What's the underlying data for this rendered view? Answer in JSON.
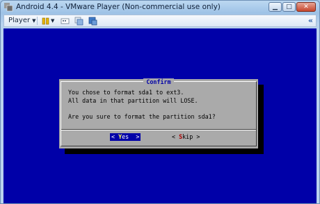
{
  "window": {
    "title": "Android 4.4 - VMware Player (Non-commercial use only)"
  },
  "toolbar": {
    "player_label": "Player"
  },
  "dialog": {
    "title": "Confirm",
    "lines": [
      "You chose to format sda1 to ext3.",
      "All data in that partition will LOSE.",
      "Are you sure to format the partition sda1?"
    ],
    "yes": {
      "pre": "<",
      "hot": "Y",
      "rest": "es",
      "post": ">"
    },
    "skip": {
      "pre": "<",
      "hot": "S",
      "rest": "kip",
      "post": ">"
    }
  },
  "colors": {
    "screen_bg": "#0000a8",
    "dialog_bg": "#aaaaaa",
    "dialog_title": "#0000a8"
  }
}
